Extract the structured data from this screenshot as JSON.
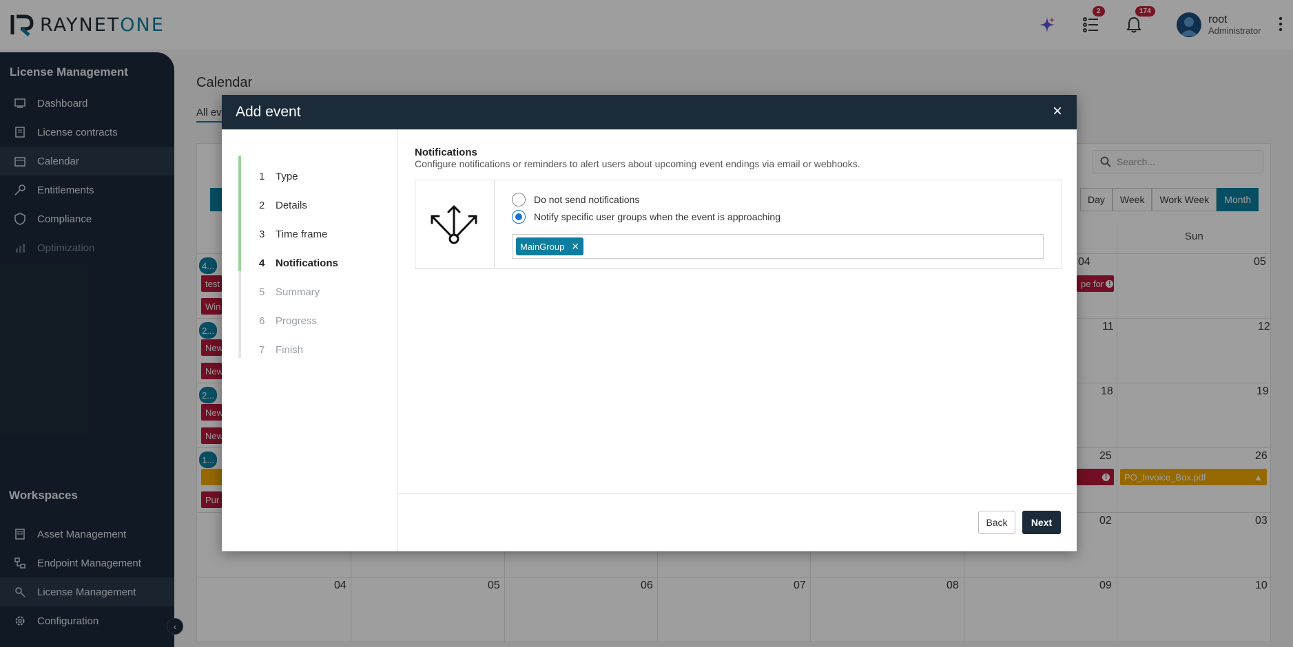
{
  "brand": {
    "name_main": "RAYNET",
    "name_accent": "ONE"
  },
  "topbar": {
    "tasks_badge": "2",
    "notifications_badge": "174",
    "user_name": "root",
    "user_role": "Administrator"
  },
  "sidebar": {
    "section_title": "License Management",
    "items": [
      {
        "label": "Dashboard"
      },
      {
        "label": "License contracts"
      },
      {
        "label": "Calendar"
      },
      {
        "label": "Entitlements"
      },
      {
        "label": "Compliance"
      },
      {
        "label": "Optimization"
      }
    ],
    "workspaces_title": "Workspaces",
    "workspaces": [
      {
        "label": "Asset Management"
      },
      {
        "label": "Endpoint Management"
      },
      {
        "label": "License Management"
      },
      {
        "label": "Configuration"
      }
    ]
  },
  "calendar": {
    "title": "Calendar",
    "tab_label": "All ev",
    "search_placeholder": "Search...",
    "views": [
      "Day",
      "Week",
      "Work Week",
      "Month"
    ],
    "sun_header": "Sun",
    "days": [
      "04",
      "05",
      "11",
      "12",
      "18",
      "19",
      "25",
      "26",
      "02",
      "03",
      "04",
      "05",
      "06",
      "07",
      "08",
      "09",
      "10"
    ],
    "event_left_labels": [
      "4...",
      "test",
      "Win",
      "2...",
      "New",
      "New",
      "2...",
      "New",
      "New",
      "1...",
      "",
      "Pur"
    ],
    "event_pe_for": "pe for",
    "event_invoice": "PO_Invoice_Box.pdf"
  },
  "modal": {
    "title": "Add event",
    "close_label": "×",
    "steps": [
      {
        "num": "1",
        "label": "Type"
      },
      {
        "num": "2",
        "label": "Details"
      },
      {
        "num": "3",
        "label": "Time frame"
      },
      {
        "num": "4",
        "label": "Notifications"
      },
      {
        "num": "5",
        "label": "Summary"
      },
      {
        "num": "6",
        "label": "Progress"
      },
      {
        "num": "7",
        "label": "Finish"
      }
    ],
    "section_title": "Notifications",
    "section_description": "Configure notifications or reminders to alert users about upcoming event endings via email or webhooks.",
    "option_none": "Do not send notifications",
    "option_groups": "Notify specific user groups when the event is approaching",
    "selected_option": "groups",
    "group_tag": "MainGroup",
    "back_label": "Back",
    "next_label": "Next"
  },
  "colors": {
    "navy": "#1c2b3a",
    "teal": "#0e7ea0",
    "event_red": "#b8193a",
    "event_orange": "#f1a800",
    "radio_blue": "#1a73d8"
  }
}
